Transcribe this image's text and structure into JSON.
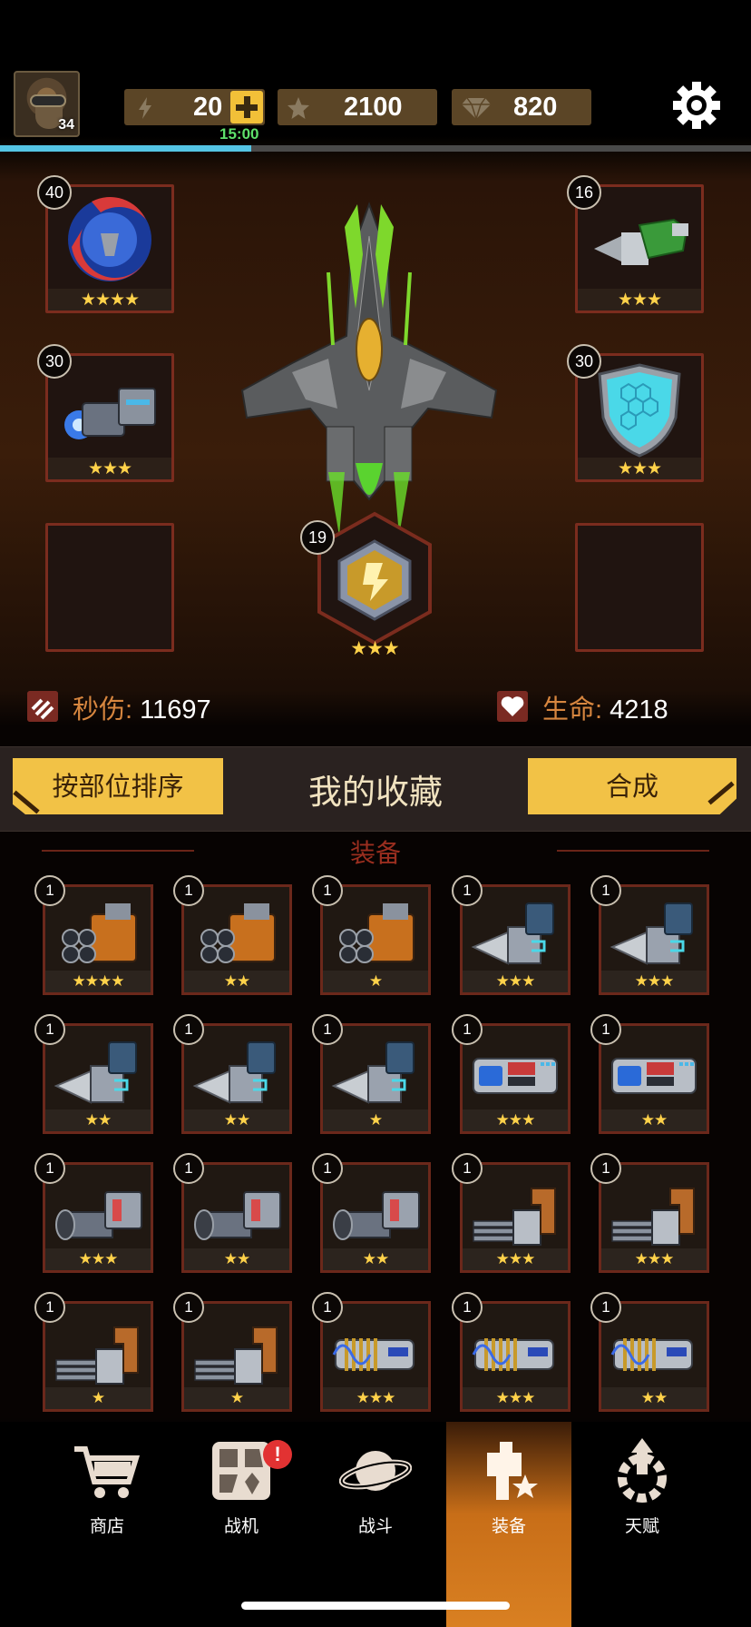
{
  "player": {
    "level": "34",
    "energy": "20",
    "energy_timer": "15:00",
    "stars": "2100",
    "gems": "820",
    "xp_progress": 0.335
  },
  "loadout": {
    "slots": [
      {
        "id": "top-left",
        "level": "40",
        "stars": "★★★★",
        "icon": "red-crescent-wingman-icon"
      },
      {
        "id": "top-right",
        "level": "16",
        "stars": "★★★",
        "icon": "green-drill-cannon-icon"
      },
      {
        "id": "mid-left",
        "level": "30",
        "stars": "★★★",
        "icon": "plasma-gun-icon"
      },
      {
        "id": "mid-right",
        "level": "30",
        "stars": "★★★",
        "icon": "hex-shield-icon"
      },
      {
        "id": "bottom-left",
        "level": "",
        "stars": "",
        "icon": "empty-slot"
      },
      {
        "id": "bottom-right",
        "level": "",
        "stars": "",
        "icon": "empty-slot"
      }
    ],
    "skill": {
      "level": "19",
      "stars": "★★★",
      "icon": "skill-strike-icon"
    }
  },
  "stats": {
    "dps_label": "秒伤:",
    "dps_value": "11697",
    "hp_label": "生命:",
    "hp_value": "4218"
  },
  "collection": {
    "sort_button": "按部位排序",
    "title": "我的收藏",
    "merge_button": "合成",
    "section_title": "装备"
  },
  "inventory": [
    {
      "level": "1",
      "stars": "★★★★",
      "type": "gatling"
    },
    {
      "level": "1",
      "stars": "★★",
      "type": "gatling"
    },
    {
      "level": "1",
      "stars": "★",
      "type": "gatling"
    },
    {
      "level": "1",
      "stars": "★★★",
      "type": "drill"
    },
    {
      "level": "1",
      "stars": "★★★",
      "type": "drill"
    },
    {
      "level": "1",
      "stars": "★★",
      "type": "drill"
    },
    {
      "level": "1",
      "stars": "★★",
      "type": "drill"
    },
    {
      "level": "1",
      "stars": "★",
      "type": "drill"
    },
    {
      "level": "1",
      "stars": "★★★",
      "type": "launcher"
    },
    {
      "level": "1",
      "stars": "★★",
      "type": "launcher"
    },
    {
      "level": "1",
      "stars": "★★★",
      "type": "cannon"
    },
    {
      "level": "1",
      "stars": "★★",
      "type": "cannon"
    },
    {
      "level": "1",
      "stars": "★★",
      "type": "cannon"
    },
    {
      "level": "1",
      "stars": "★★★",
      "type": "minigun"
    },
    {
      "level": "1",
      "stars": "★★★",
      "type": "minigun"
    },
    {
      "level": "1",
      "stars": "★",
      "type": "minigun"
    },
    {
      "level": "1",
      "stars": "★",
      "type": "minigun"
    },
    {
      "level": "1",
      "stars": "★★★",
      "type": "coil"
    },
    {
      "level": "1",
      "stars": "★★★",
      "type": "coil"
    },
    {
      "level": "1",
      "stars": "★★",
      "type": "coil"
    }
  ],
  "nav": [
    {
      "label": "商店",
      "icon": "cart-icon"
    },
    {
      "label": "战机",
      "icon": "fighters-icon",
      "alert": "!"
    },
    {
      "label": "战斗",
      "icon": "planet-icon"
    },
    {
      "label": "装备",
      "icon": "equipment-icon",
      "active": true
    },
    {
      "label": "天赋",
      "icon": "talent-icon"
    }
  ],
  "colors": {
    "accent": "#f2c246",
    "frame": "#7b2c1e",
    "star": "#ffd24a",
    "timer": "#5ee06a",
    "xp": "#55c4e4"
  }
}
